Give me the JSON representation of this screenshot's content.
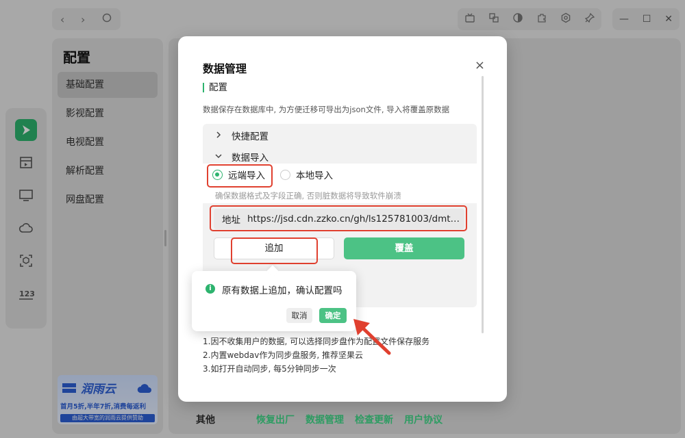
{
  "sidebar": {
    "title": "配置",
    "items": [
      {
        "label": "基础配置",
        "active": true
      },
      {
        "label": "影视配置",
        "active": false
      },
      {
        "label": "电视配置",
        "active": false
      },
      {
        "label": "解析配置",
        "active": false
      },
      {
        "label": "网盘配置",
        "active": false
      }
    ]
  },
  "promo": {
    "brand": "润雨云",
    "sub": "首月5折,半年7折,消费每返利",
    "bar": "由超大带宽的润雨云提供赞助"
  },
  "bottom": {
    "label": "其他",
    "links": [
      "恢复出厂",
      "数据管理",
      "检查更新",
      "用户协议"
    ]
  },
  "modal": {
    "title": "数据管理",
    "close": "×",
    "section": "配置",
    "description": "数据保存在数据库中, 为方便迁移可导出为json文件, 导入将覆盖原数据",
    "collapse": {
      "quick": "快捷配置",
      "import": "数据导入"
    },
    "radios": {
      "remote": "远端导入",
      "local": "本地导入",
      "selected": "remote"
    },
    "hint": "确保数据格式及字段正确, 否则脏数据将导致软件崩溃",
    "address": {
      "label": "地址",
      "value": "https://jsd.cdn.zzko.cn/gh/ls125781003/dmtg..."
    },
    "buttons": {
      "append": "追加",
      "cover": "覆盖"
    },
    "notes": [
      "1.因不收集用户的数据, 可以选择同步盘作为配置文件保存服务",
      "2.内置webdav作为同步盘服务, 推荐坚果云",
      "3.如打开自动同步, 每5分钟同步一次"
    ]
  },
  "popconfirm": {
    "icon": "i",
    "message": "原有数据上追加，确认配置吗",
    "cancel": "取消",
    "ok": "确定"
  },
  "colors": {
    "accent": "#2db36e",
    "annotation": "#e0402f"
  }
}
